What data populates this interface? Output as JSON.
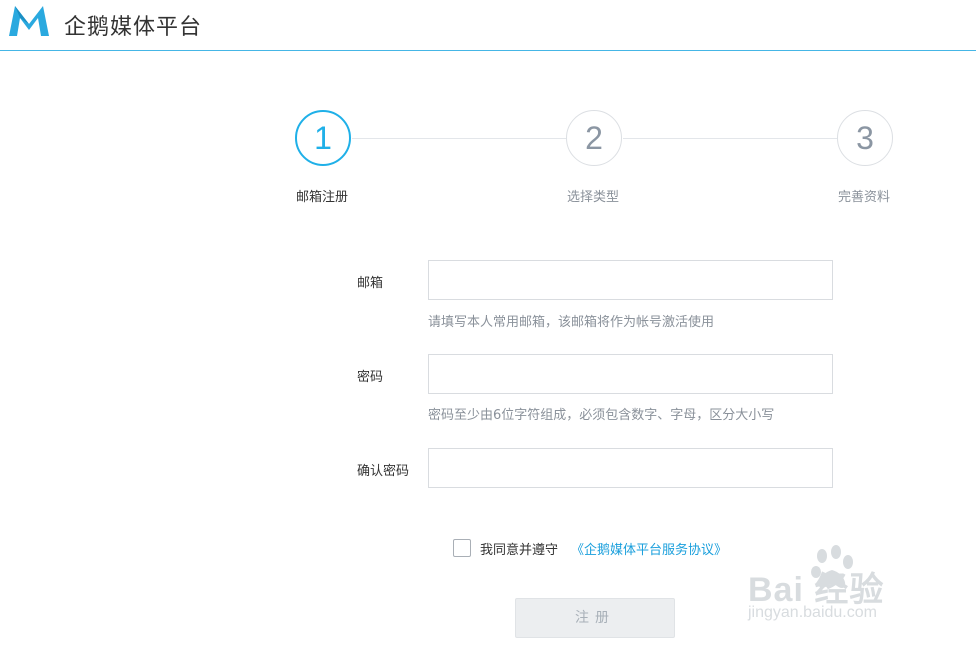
{
  "header": {
    "brand_name": "企鹅媒体平台",
    "logo_icon": "qq-media-logo-icon",
    "accent_color": "#1fb0e8"
  },
  "steps": [
    {
      "number": "1",
      "label": "邮箱注册",
      "active": true
    },
    {
      "number": "2",
      "label": "选择类型",
      "active": false
    },
    {
      "number": "3",
      "label": "完善资料",
      "active": false
    }
  ],
  "form": {
    "email": {
      "label": "邮箱",
      "value": "",
      "placeholder": "",
      "hint": "请填写本人常用邮箱，该邮箱将作为帐号激活使用"
    },
    "password": {
      "label": "密码",
      "value": "",
      "placeholder": "",
      "hint": "密码至少由6位字符组成，必须包含数字、字母，区分大小写"
    },
    "confirm_password": {
      "label": "确认密码",
      "value": "",
      "placeholder": ""
    }
  },
  "agreement": {
    "checked": false,
    "text": "我同意并遵守",
    "link_text": "《企鹅媒体平台服务协议》"
  },
  "register_button": {
    "label": "注册",
    "enabled": false
  },
  "watermark": {
    "brand_text": "Bai  经验",
    "url_text": "jingyan.baidu.com",
    "icon": "baidu-paw-icon"
  }
}
